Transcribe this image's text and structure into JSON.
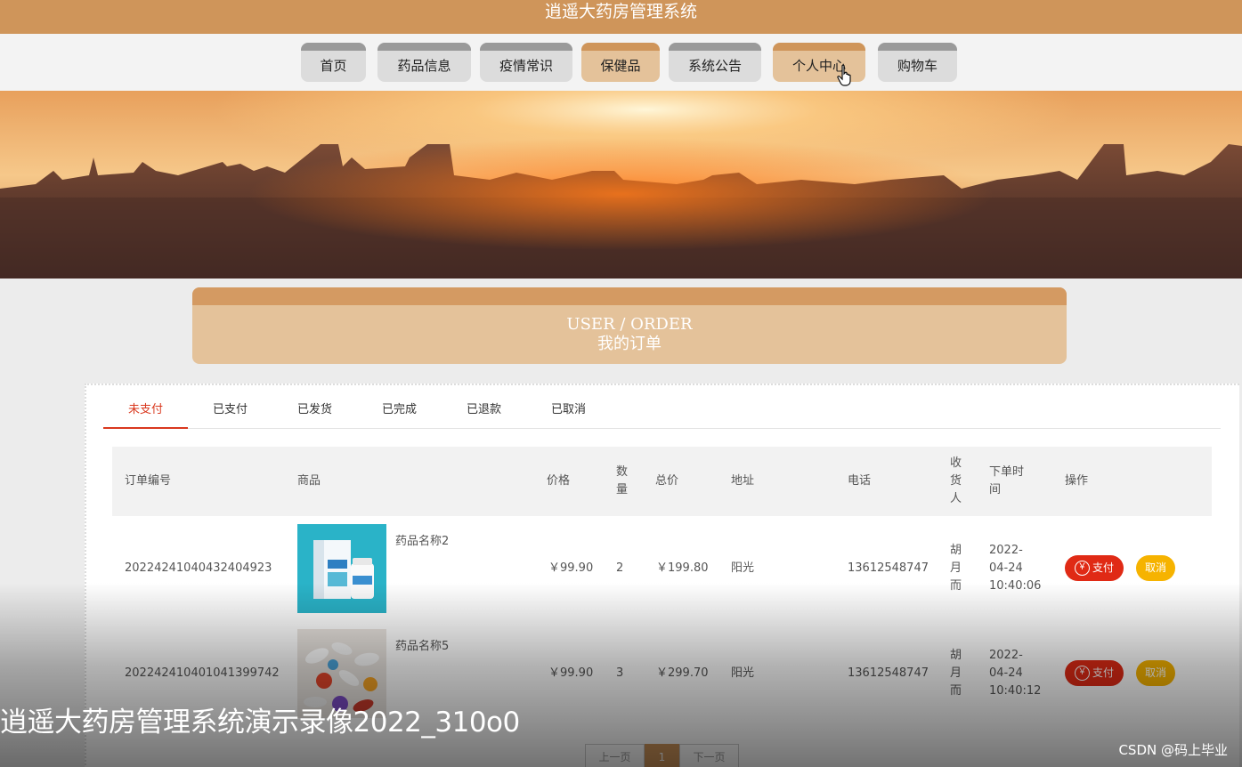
{
  "header": {
    "site_title": "逍遥大药房管理系统"
  },
  "nav": {
    "items": [
      {
        "label": "首页"
      },
      {
        "label": "药品信息"
      },
      {
        "label": "疫情常识"
      },
      {
        "label": "保健品"
      },
      {
        "label": "系统公告"
      },
      {
        "label": "个人中心"
      },
      {
        "label": "购物车"
      }
    ]
  },
  "order_title": {
    "en": "USER / ORDER",
    "cn": "我的订单"
  },
  "tabs": [
    "未支付",
    "已支付",
    "已发货",
    "已完成",
    "已退款",
    "已取消"
  ],
  "table": {
    "headers": {
      "order_no": "订单编号",
      "product": "商品",
      "price": "价格",
      "qty": [
        "数",
        "量"
      ],
      "total": "总价",
      "address": "地址",
      "phone": "电话",
      "receiver": [
        "收",
        "货",
        "人"
      ],
      "time": [
        "下单时",
        "间"
      ],
      "action": "操作"
    },
    "rows": [
      {
        "order_no": "20224241040432404923",
        "product_name": "药品名称2",
        "price": "￥99.90",
        "qty": "2",
        "total": "￥199.80",
        "address": "阳光",
        "phone": "13612548747",
        "receiver": [
          "胡",
          "月",
          "而"
        ],
        "time": [
          "2022-",
          "04-24",
          "10:40:06"
        ]
      },
      {
        "order_no": "20224241040104139​9742",
        "product_name": "药品名称5",
        "price": "￥99.90",
        "qty": "3",
        "total": "￥299.70",
        "address": "阳光",
        "phone": "13612548747",
        "receiver": [
          "胡",
          "月",
          "而"
        ],
        "time": [
          "2022-",
          "04-24",
          "10:40:12"
        ]
      }
    ],
    "pay_label": "支付",
    "cancel_label": "取消",
    "pay_symbol": "￥"
  },
  "pagination": {
    "prev": "上一页",
    "current": "1",
    "next": "下一页"
  },
  "overlay": {
    "caption": "逍遥大药房管理系统演示录像2022_310o0",
    "watermark": "CSDN @码上毕业"
  },
  "colors": {
    "brand": "#cf955a",
    "nav_warm": "#e4c29a",
    "pay": "#e02a15",
    "cancel": "#f6b300",
    "tab_active": "#d9381e"
  }
}
